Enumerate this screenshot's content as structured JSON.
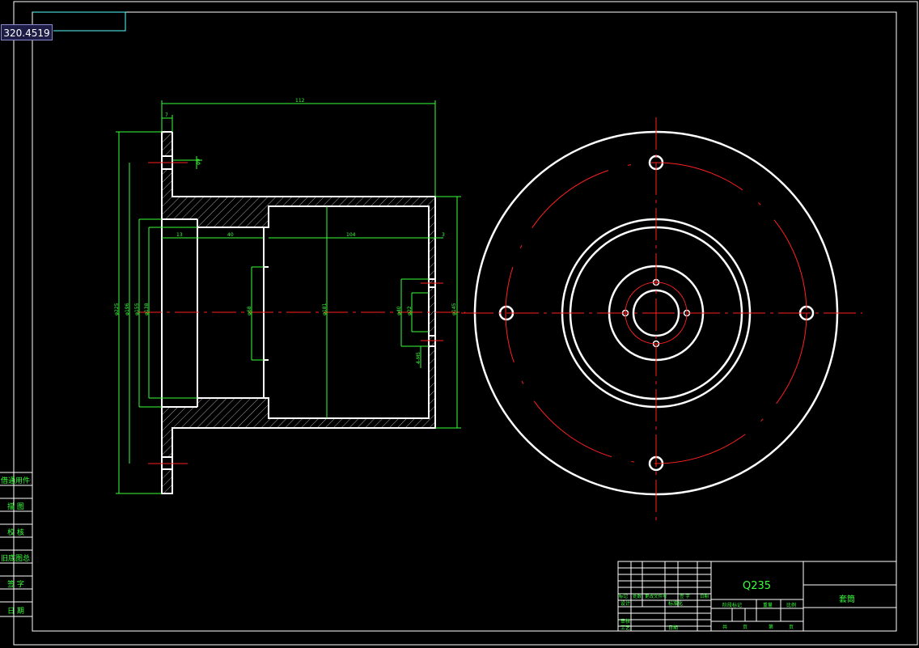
{
  "coordinate_readout": "320.4519",
  "side_labels": [
    "借通用件登记",
    "描 图",
    "校 核",
    "旧底图总号",
    "签 字",
    "日 期"
  ],
  "title_block": {
    "material": "Q235",
    "part_name": "套筒",
    "rev_row": [
      "标记",
      "处数",
      "更改文件号",
      "签 字",
      "日期"
    ],
    "role_rows": [
      "设计",
      "审核",
      "工艺"
    ],
    "std_label": "标准化",
    "approve_label": "日期",
    "stage_header": [
      "阶段标记",
      "重量",
      "比例"
    ],
    "sheet_row": [
      "共",
      "页",
      "第",
      "页"
    ]
  },
  "dimensions": {
    "overall_length": "112",
    "flange_thickness": "7",
    "hole_dia": "φ9",
    "bore_step_len": "13",
    "mid_len": "40",
    "cavity_len": "104",
    "end_wall": "3",
    "outer_dia": "φ225",
    "bolt_circle": "φ196",
    "d3": "φ155",
    "d4": "φ138",
    "d5": "φ68",
    "cavity_dia": "φ181",
    "d7": "φ40",
    "d8": "φ22",
    "thread": "4-M5",
    "hub_dia": "φ145"
  },
  "colors": {
    "outline": "#ffffff",
    "dimension": "#39ff39",
    "centerline": "#ff2020",
    "hatch": "#ffffff",
    "frame": "#ffffff",
    "title_text": "#39ff39"
  }
}
